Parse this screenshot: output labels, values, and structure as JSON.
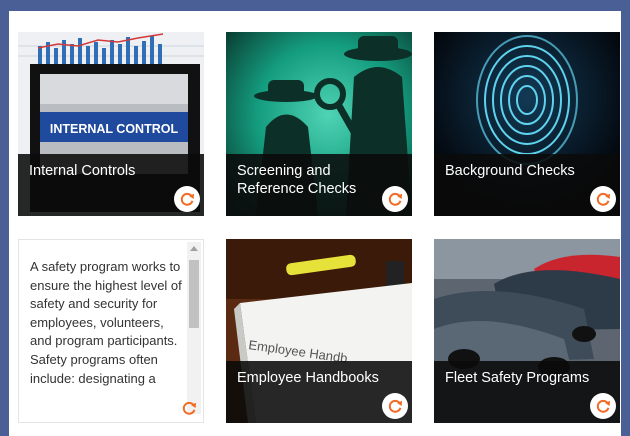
{
  "colors": {
    "page_background": "#4a5f96",
    "accent": "#f26a21",
    "caption_overlay": "#0a0a0a"
  },
  "cards": [
    {
      "title": "Internal Controls",
      "image_text": "INTERNAL CONTROL",
      "icon": "flip-icon"
    },
    {
      "title": "Screening and Reference Checks",
      "icon": "flip-icon"
    },
    {
      "title": "Background Checks",
      "icon": "flip-icon"
    },
    {
      "back_text": "A safety program works to ensure the highest level of safety and security for employees, volunteers, and program participants. Safety programs often include: designating a",
      "icon": "flip-icon"
    },
    {
      "title": "Employee Handbooks",
      "image_text": "Employee Handb",
      "icon": "flip-icon"
    },
    {
      "title": "Fleet Safety Programs",
      "icon": "flip-icon"
    }
  ]
}
